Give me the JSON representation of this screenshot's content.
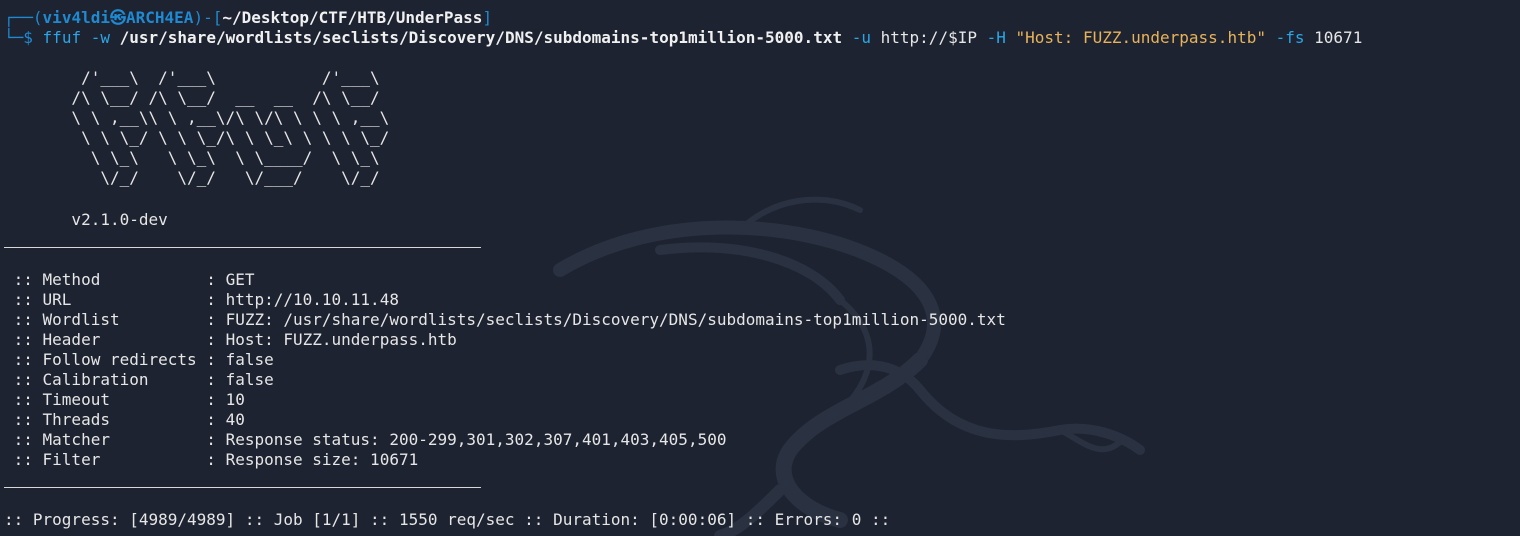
{
  "prompt": {
    "corner_top": "┌──",
    "corner_bottom": "└─",
    "open_paren": "(",
    "user": "viv4ldi",
    "at_symbol": "㉿",
    "host": "ARCH4EA",
    "close_paren_dash": ")-[",
    "path": "~/Desktop/CTF/HTB/UnderPass",
    "close_bracket": "]",
    "dollar": "$"
  },
  "command": {
    "program": "ffuf",
    "w_flag": "-w",
    "wordlist": "/usr/share/wordlists/seclists/Discovery/DNS/subdomains-top1million-5000.txt",
    "u_flag": "-u",
    "url": "http://$IP",
    "h_flag": "-H",
    "header": "\"Host: FUZZ.underpass.htb\"",
    "fs_flag": "-fs",
    "fs_value": "10671"
  },
  "banner": {
    "lines": [
      "        /'___\\  /'___\\           /'___\\",
      "       /\\ \\__/ /\\ \\__/  __  __  /\\ \\__/",
      "       \\ \\ ,__\\\\ \\ ,__\\/\\ \\/\\ \\ \\ \\ ,__\\",
      "        \\ \\ \\_/ \\ \\ \\_/\\ \\ \\_\\ \\ \\ \\ \\_/",
      "         \\ \\_\\   \\ \\_\\  \\ \\____/  \\ \\_\\",
      "          \\/_/    \\/_/   \\/___/    \\/_/"
    ],
    "version": "       v2.1.0-dev"
  },
  "config": [
    {
      "key": " :: Method           ",
      "value": ": GET"
    },
    {
      "key": " :: URL              ",
      "value": ": http://10.10.11.48"
    },
    {
      "key": " :: Wordlist         ",
      "value": ": FUZZ: /usr/share/wordlists/seclists/Discovery/DNS/subdomains-top1million-5000.txt"
    },
    {
      "key": " :: Header           ",
      "value": ": Host: FUZZ.underpass.htb"
    },
    {
      "key": " :: Follow redirects ",
      "value": ": false"
    },
    {
      "key": " :: Calibration      ",
      "value": ": false"
    },
    {
      "key": " :: Timeout          ",
      "value": ": 10"
    },
    {
      "key": " :: Threads          ",
      "value": ": 40"
    },
    {
      "key": " :: Matcher          ",
      "value": ": Response status: 200-299,301,302,307,401,403,405,500"
    },
    {
      "key": " :: Filter           ",
      "value": ": Response size: 10671"
    }
  ],
  "progress": ":: Progress: [4989/4989] :: Job [1/1] :: 1550 req/sec :: Duration: [0:00:06] :: Errors: 0 ::",
  "colors": {
    "background": "#1d2330",
    "prompt_blue": "#1f8ad2",
    "command_blue": "#2aa5e8",
    "string_orange": "#e8b35a",
    "text": "#e6e6e6"
  },
  "icons": {
    "background_watermark": "kali-dragon-icon"
  }
}
